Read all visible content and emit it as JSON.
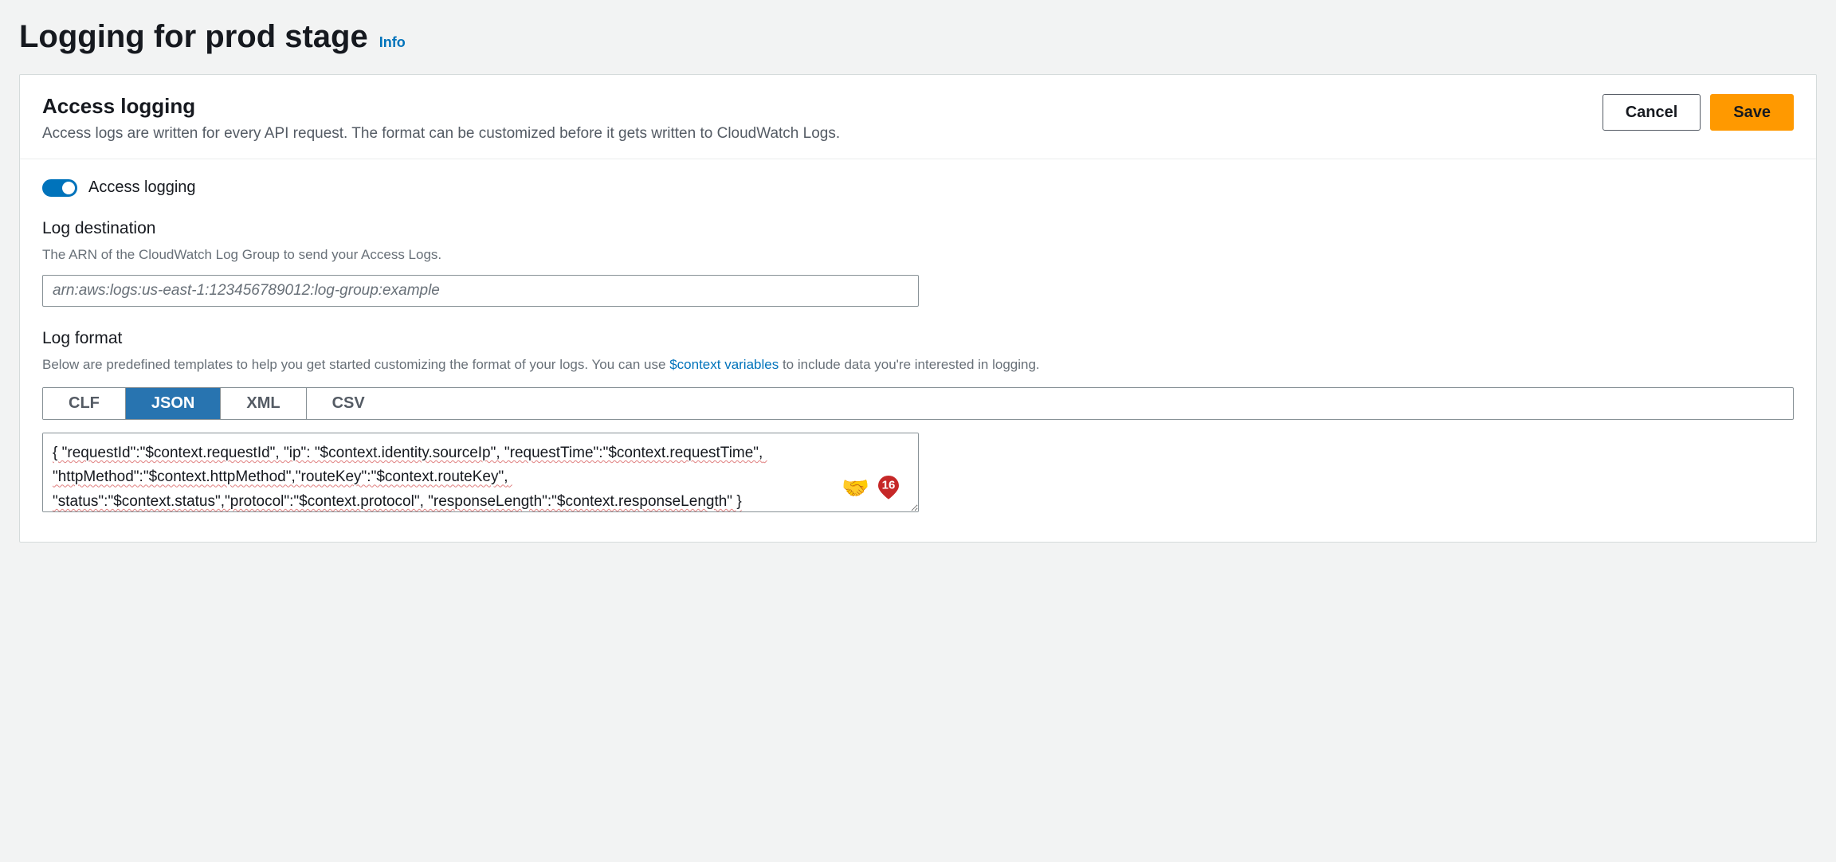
{
  "header": {
    "title": "Logging for prod stage",
    "info_link": "Info"
  },
  "panel": {
    "title": "Access logging",
    "description": "Access logs are written for every API request. The format can be customized before it gets written to CloudWatch Logs.",
    "cancel_label": "Cancel",
    "save_label": "Save"
  },
  "toggle": {
    "label": "Access logging",
    "state": "on"
  },
  "log_destination": {
    "label": "Log destination",
    "help": "The ARN of the CloudWatch Log Group to send your Access Logs.",
    "placeholder": "arn:aws:logs:us-east-1:123456789012:log-group:example",
    "value": ""
  },
  "log_format": {
    "label": "Log format",
    "help_prefix": "Below are predefined templates to help you get started customizing the format of your logs. You can use ",
    "help_link": "$context variables",
    "help_suffix": " to include data you're interested in logging.",
    "tabs": [
      "CLF",
      "JSON",
      "XML",
      "CSV"
    ],
    "active_tab": "JSON",
    "value": "{ \"requestId\":\"$context.requestId\", \"ip\": \"$context.identity.sourceIp\", \"requestTime\":\"$context.requestTime\", \"httpMethod\":\"$context.httpMethod\",\"routeKey\":\"$context.routeKey\", \"status\":\"$context.status\",\"protocol\":\"$context.protocol\", \"responseLength\":\"$context.responseLength\" }"
  },
  "badge": {
    "emoji": "🤝",
    "count": "16"
  }
}
